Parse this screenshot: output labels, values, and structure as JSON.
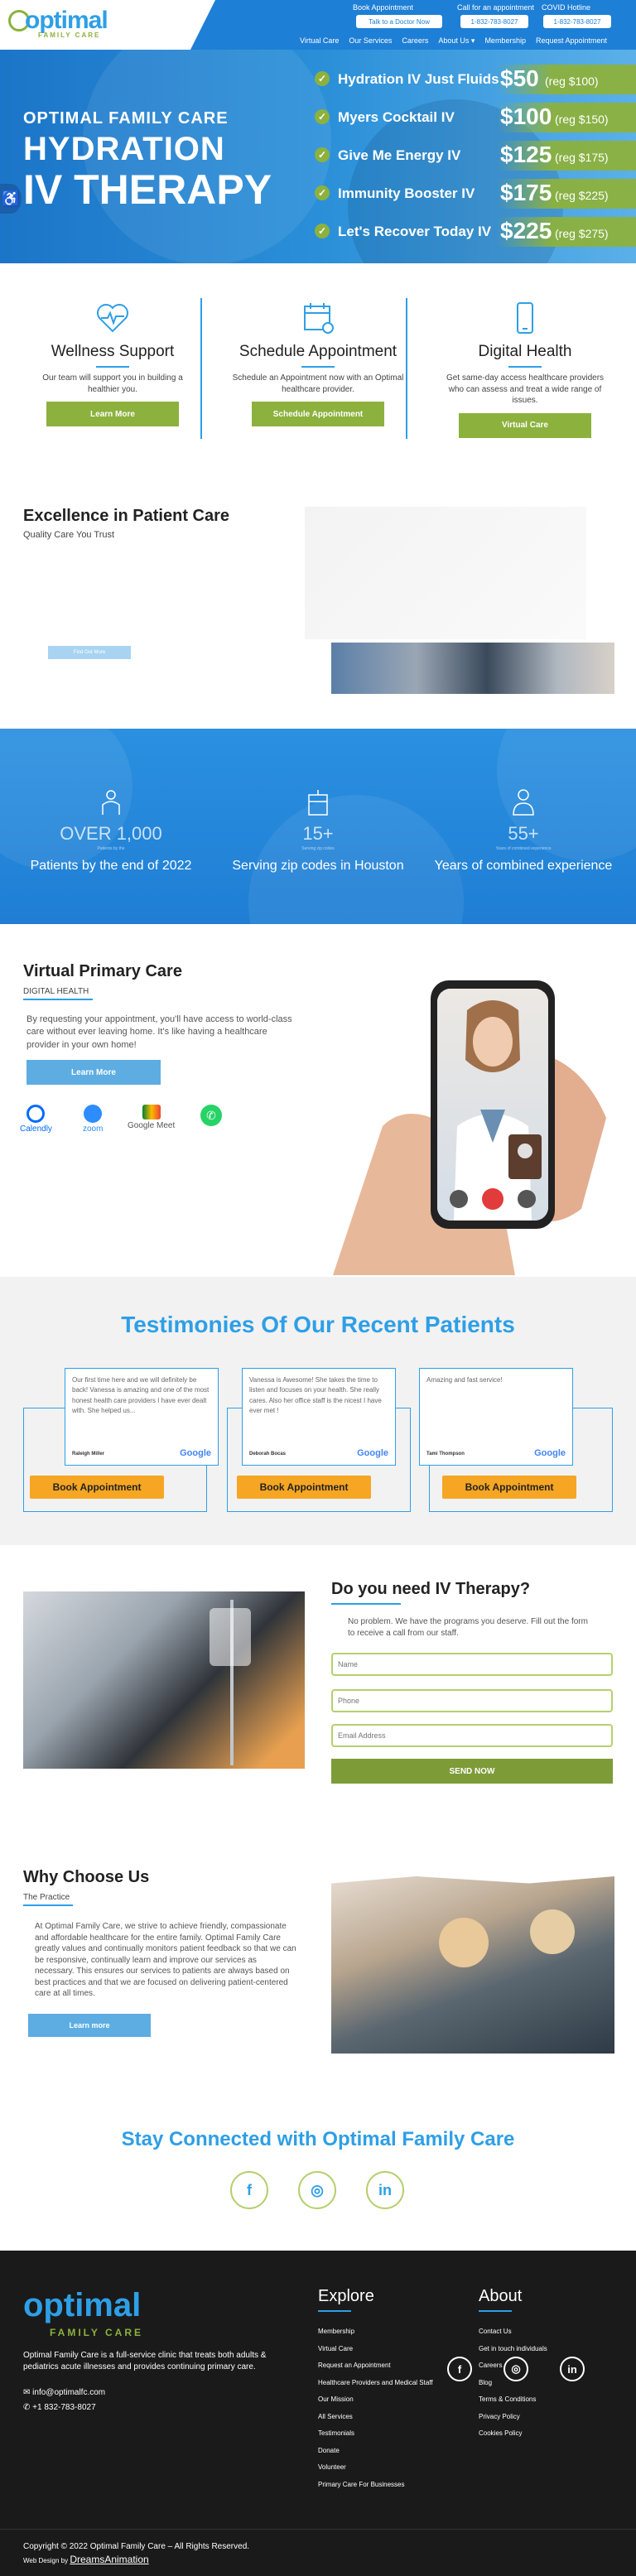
{
  "header": {
    "logo_text": "optimal",
    "logo_sub": "FAMILY CARE",
    "book_label": "Book Appointment",
    "book_button": "Talk to a Doctor Now",
    "call_label": "Call for an appointment",
    "call_button": "1-832-783-8027",
    "covid_label": "COVID Hotline",
    "covid_button": "1-832-783-8027",
    "nav": [
      "Virtual Care",
      "Our Services",
      "Careers",
      "About Us ▾",
      "Membership",
      "Request Appointment"
    ]
  },
  "hero": {
    "line1": "OPTIMAL FAMILY CARE",
    "line2": "HYDRATION",
    "line3": "IV THERAPY",
    "items": [
      {
        "name": "Hydration IV Just Fluids",
        "price": "$50",
        "reg": "(reg $100)"
      },
      {
        "name": "Myers Cocktail IV",
        "price": "$100",
        "reg": "(reg $150)"
      },
      {
        "name": "Give Me Energy IV",
        "price": "$125",
        "reg": "(reg $175)"
      },
      {
        "name": "Immunity Booster IV",
        "price": "$175",
        "reg": "(reg $225)"
      },
      {
        "name": "Let's Recover Today IV",
        "price": "$225",
        "reg": "(reg $275)"
      }
    ]
  },
  "services": [
    {
      "title": "Wellness Support",
      "text": "Our team will support you in building a healthier you.",
      "button": "Learn More"
    },
    {
      "title": "Schedule Appointment",
      "text": "Schedule an Appointment now with an Optimal healthcare provider.",
      "button": "Schedule Appointment"
    },
    {
      "title": "Digital Health",
      "text": "Get same-day access healthcare providers who can assess and treat a wide range of issues.",
      "button": "Virtual Care"
    }
  ],
  "excellence": {
    "title": "Excellence in Patient Care",
    "subtitle": "Quality Care You Trust",
    "button": "Find Out More"
  },
  "stats": [
    {
      "number": "OVER 1,000",
      "small": "Patients by the",
      "label": "Patients by the end of 2022"
    },
    {
      "number": "15+",
      "small": "Serving zip codes",
      "label": "Serving zip codes in Houston"
    },
    {
      "number": "55+",
      "small": "Years of combined experience",
      "label": "Years of combined experience"
    }
  ],
  "virtual": {
    "title": "Virtual Primary Care",
    "subtitle": "DIGITAL HEALTH",
    "text": "By requesting your appointment, you'll have access to world-class care without ever leaving home. It's like having a healthcare provider in your own home!",
    "button": "Learn More",
    "brands": [
      "Calendly",
      "zoom",
      "Google Meet",
      ""
    ]
  },
  "testimonies": {
    "title": "Testimonies Of Our Recent Patients",
    "items": [
      {
        "text": "Our first time here and we will definitely be back! Vanessa is amazing and one of the most honest health care providers I have ever dealt with. She helped us...",
        "author": "Raleigh Miller",
        "badge": "Google"
      },
      {
        "text": "Vanessa is Awesome! She takes the time to listen and focuses on your health. She really cares. Also her office staff is the nicest I have ever met !",
        "author": "Deborah Bocas",
        "badge": "Google"
      },
      {
        "text": "Amazing and fast service!",
        "author": "Tami Thompson",
        "badge": "Google"
      }
    ],
    "book_button": "Book Appointment"
  },
  "iv_form": {
    "title": "Do you need IV Therapy?",
    "text": "No problem. We have the programs you deserve. Fill out the form to receive a call from our staff.",
    "name_placeholder": "Name",
    "phone_placeholder": "Phone",
    "email_placeholder": "Email Address",
    "submit": "SEND NOW"
  },
  "why": {
    "title": "Why Choose Us",
    "subtitle": "The Practice",
    "text": "At Optimal Family Care, we strive to achieve friendly, compassionate and affordable healthcare for the entire family. Optimal Family Care greatly values and continually monitors patient feedback so that we can be responsive, continually learn and improve our services as necessary. This ensures our services to patients are always based on best practices and that we are focused on delivering patient-centered care at all times.",
    "button": "Learn more"
  },
  "stay": {
    "title": "Stay Connected with Optimal Family Care",
    "icons": [
      "f",
      "◎",
      "in"
    ]
  },
  "footer": {
    "logo_text": "optimal",
    "logo_sub": "FAMILY CARE",
    "description": "Optimal Family Care is a full-service clinic that treats both adults & pediatrics acute illnesses and provides continuing primary care.",
    "email": "info@optimalfc.com",
    "phone": "+1 832-783-8027",
    "explore_title": "Explore",
    "explore": [
      "Membership",
      "Virtual Care",
      "Request an Appointment",
      "Healthcare Providers and Medical Staff",
      "Our Mission",
      "All Services",
      "Testimonials",
      "Donate",
      "Volunteer",
      "Primary Care For Businesses"
    ],
    "about_title": "About",
    "about": [
      "Contact Us",
      "Get in touch individuals",
      "Careers",
      "Blog",
      "Terms & Conditions",
      "Privacy Policy",
      "Cookies Policy"
    ],
    "copyright": "Copyright © 2022 Optimal Family Care – All Rights Reserved.",
    "credit_prefix": "Web Design by ",
    "credit_link": "DreamsAnimation",
    "social": [
      "f",
      "◎",
      "in"
    ]
  },
  "colors": {
    "primary_blue": "#2e9fe6",
    "green": "#8cb13d",
    "orange": "#f6a623",
    "footer_bg": "#1a1a1a"
  }
}
